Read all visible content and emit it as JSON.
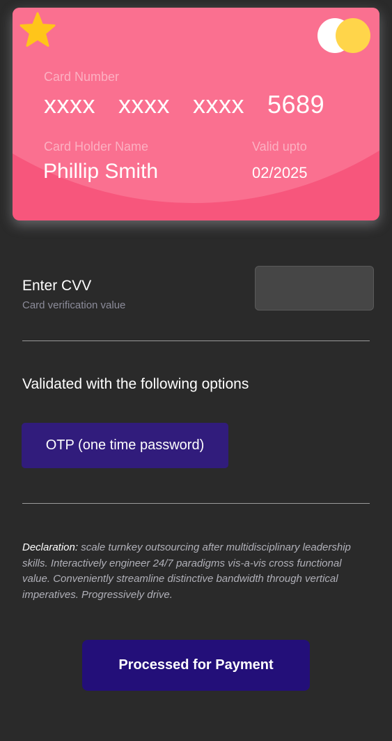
{
  "card": {
    "number_label": "Card Number",
    "number": "xxxx  xxxx  xxxx  5689",
    "holder_label": "Card Holder Name",
    "holder_name": "Phillip Smith",
    "valid_label": "Valid upto",
    "valid_date": "02/2025",
    "favorite_icon": "star-icon",
    "brand_icon": "card-network-logo",
    "colors": {
      "card": "#f7567c",
      "card_highlight": "#fa7090",
      "star": "#ffc51a",
      "logo_left": "#ffffff",
      "logo_right": "#ffd54a"
    }
  },
  "cvv": {
    "label": "Enter CVV",
    "sublabel": "Card verification value",
    "value": "",
    "placeholder": ""
  },
  "validation": {
    "heading": "Validated with the following options",
    "otp_label": "OTP (one time password)"
  },
  "declaration": {
    "title": "Declaration:",
    "text": " scale turnkey outsourcing after multidisciplinary leadership skills. Interactively engineer 24/7 paradigms vis-a-vis cross functional value. Conveniently streamline distinctive bandwidth through vertical imperatives. Progressively drive."
  },
  "payment": {
    "button_label": "Processed for Payment"
  },
  "colors": {
    "background": "#2a2a2a",
    "otp_button": "#311c7c",
    "pay_button": "#230f79"
  }
}
